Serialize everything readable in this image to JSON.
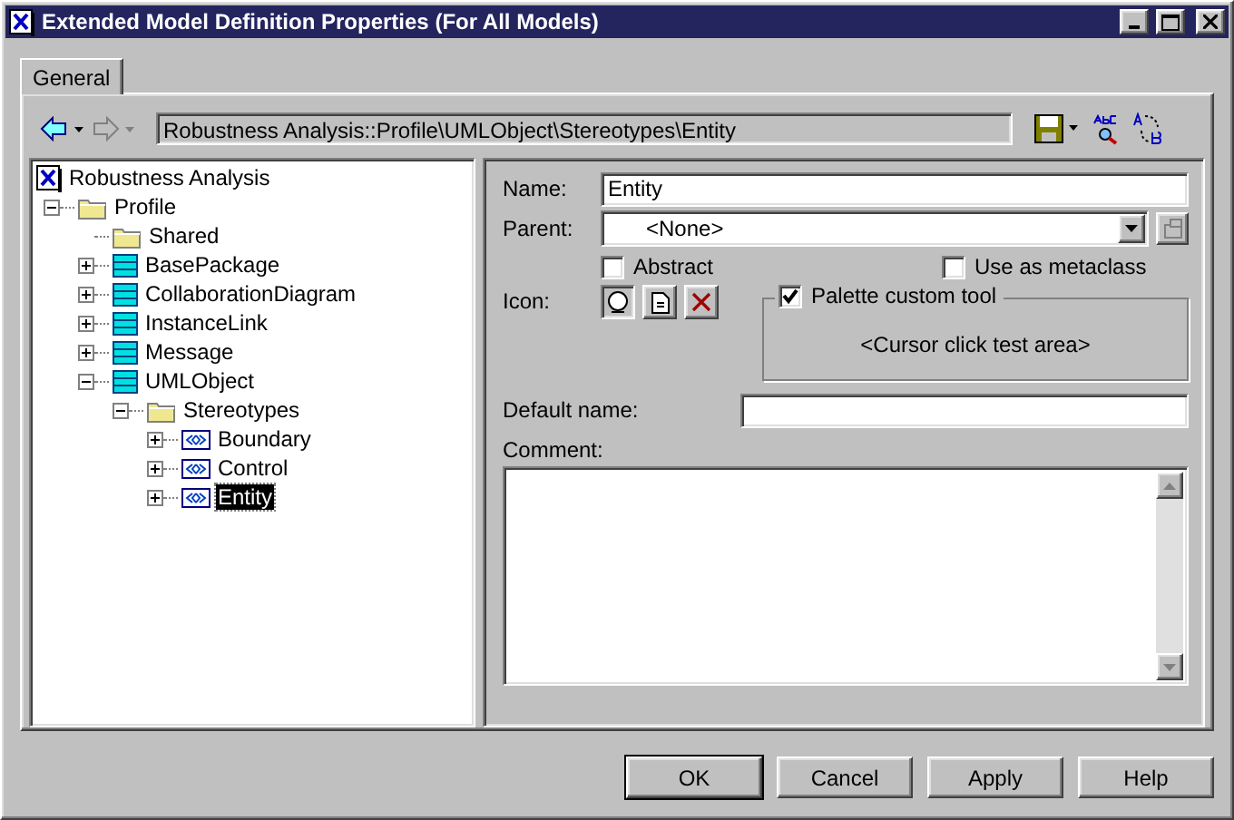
{
  "window": {
    "title": "Extended Model Definition Properties (For All Models)"
  },
  "tabs": [
    {
      "label": "General",
      "selected": true
    }
  ],
  "toolbar": {
    "back_enabled": true,
    "forward_enabled": false,
    "path": "Robustness Analysis::Profile\\UMLObject\\Stereotypes\\Entity"
  },
  "tree": [
    {
      "label": "Robustness Analysis",
      "kind": "model",
      "selected": false,
      "children": [
        {
          "label": "Profile",
          "kind": "folder",
          "expanded": true,
          "selected": false,
          "children": [
            {
              "label": "Shared",
              "kind": "folder",
              "selected": false
            },
            {
              "label": "BasePackage",
              "kind": "package",
              "expanded": false,
              "selected": false
            },
            {
              "label": "CollaborationDiagram",
              "kind": "package",
              "expanded": false,
              "selected": false
            },
            {
              "label": "InstanceLink",
              "kind": "package",
              "expanded": false,
              "selected": false
            },
            {
              "label": "Message",
              "kind": "package",
              "expanded": false,
              "selected": false
            },
            {
              "label": "UMLObject",
              "kind": "package",
              "expanded": true,
              "selected": false,
              "children": [
                {
                  "label": "Stereotypes",
                  "kind": "folder",
                  "expanded": true,
                  "selected": false,
                  "children": [
                    {
                      "label": "Boundary",
                      "kind": "stereotype",
                      "expanded": false,
                      "selected": false
                    },
                    {
                      "label": "Control",
                      "kind": "stereotype",
                      "expanded": false,
                      "selected": false
                    },
                    {
                      "label": "Entity",
                      "kind": "stereotype",
                      "expanded": false,
                      "selected": true
                    }
                  ]
                }
              ]
            }
          ]
        }
      ]
    }
  ],
  "form": {
    "name_label": "Name:",
    "name_value": "Entity",
    "parent_label": "Parent:",
    "parent_value": "<None>",
    "abstract": {
      "label": "Abstract",
      "checked": false
    },
    "metaclass": {
      "label": "Use as metaclass",
      "checked": false
    },
    "icon_label": "Icon:",
    "palette": {
      "label": "Palette custom tool",
      "checked": true,
      "test_area": "<Cursor click test area>"
    },
    "default_name_label": "Default name:",
    "comment_label": "Comment:"
  },
  "buttons": [
    {
      "label": "OK",
      "default": true
    },
    {
      "label": "Cancel",
      "default": false
    },
    {
      "label": "Apply",
      "default": false
    },
    {
      "label": "Help",
      "default": false
    }
  ]
}
